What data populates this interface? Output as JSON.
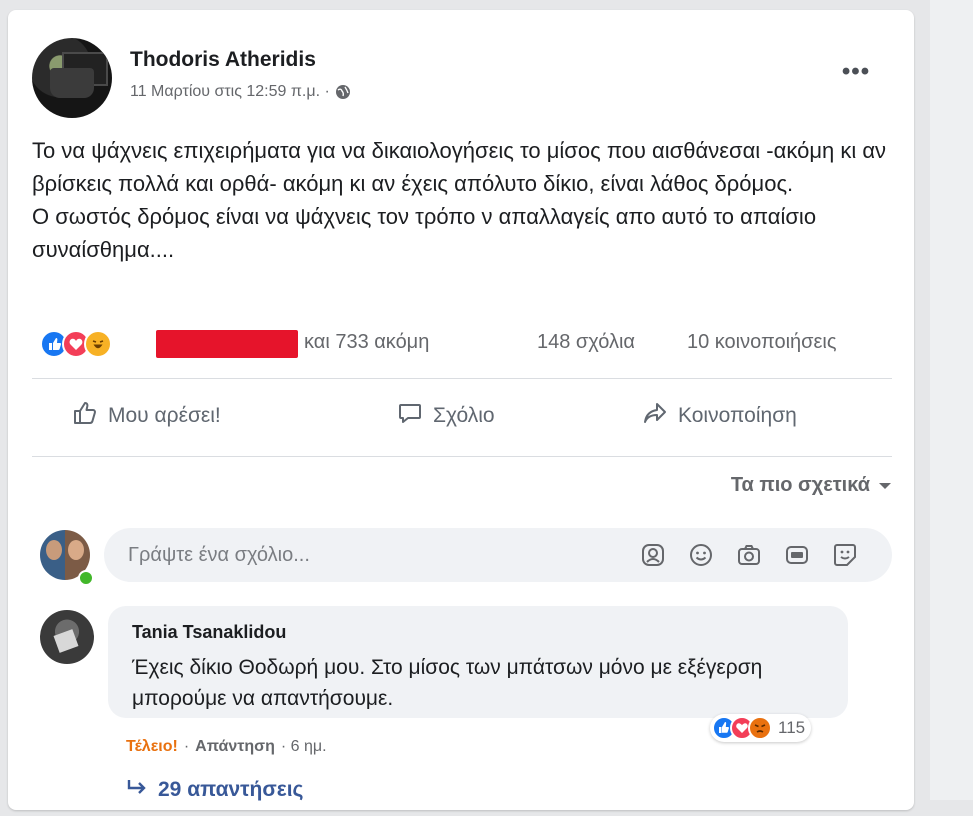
{
  "post": {
    "author": "Thodoris Atheridis",
    "timestamp": "11 Μαρτίου στις 12:59 π.μ. ·",
    "privacy_icon": "globe-icon",
    "body": [
      "Το να ψάχνεις επιχειρήματα για να δικαιολογήσεις το μίσος που αισθάνεσαι -ακόμη κι αν βρίσκεις πολλά και ορθά- ακόμη κι αν έχεις απόλυτο δίκιο, είναι λάθος δρόμος.",
      "Ο σωστός δρόμος είναι να ψάχνεις τον τρόπο ν απαλλαγείς απο αυτό το απαίσιο συναίσθημα...."
    ]
  },
  "reactions": {
    "types": [
      "like",
      "love",
      "haha"
    ],
    "others_text": "και 733 ακόμη",
    "comments": "148 σχόλια",
    "shares": "10 κοινοποιήσεις"
  },
  "actions": {
    "like": "Μου αρέσει!",
    "comment": "Σχόλιο",
    "share": "Κοινοποίηση"
  },
  "sort": {
    "label": "Τα πιο σχετικά"
  },
  "composer": {
    "placeholder": "Γράψτε ένα σχόλιο...",
    "tools": [
      "avatar-sticker-icon",
      "emoji-icon",
      "camera-icon",
      "gif-icon",
      "sticker-icon"
    ]
  },
  "comment": {
    "author": "Tania Tsanaklidou",
    "text": "Έχεις δίκιο Θοδωρή μου. Στο μίσος των μπάτσων μόνο με εξέγερση μπορούμε να απαντήσουμε.",
    "reaction_types": [
      "like",
      "love",
      "angry"
    ],
    "reaction_count": "115",
    "reaction_label": "Τέλειο!",
    "reply": "Απάντηση",
    "separator": "·",
    "time": "· 6 ημ.",
    "replies": "29 απαντήσεις"
  },
  "colors": {
    "facebook_blue": "#1877f2",
    "love_red": "#f33e58",
    "haha_yellow": "#f7b125",
    "angry_orange": "#e9710f",
    "redaction_red": "#e6142b",
    "link_blue": "#385898"
  }
}
